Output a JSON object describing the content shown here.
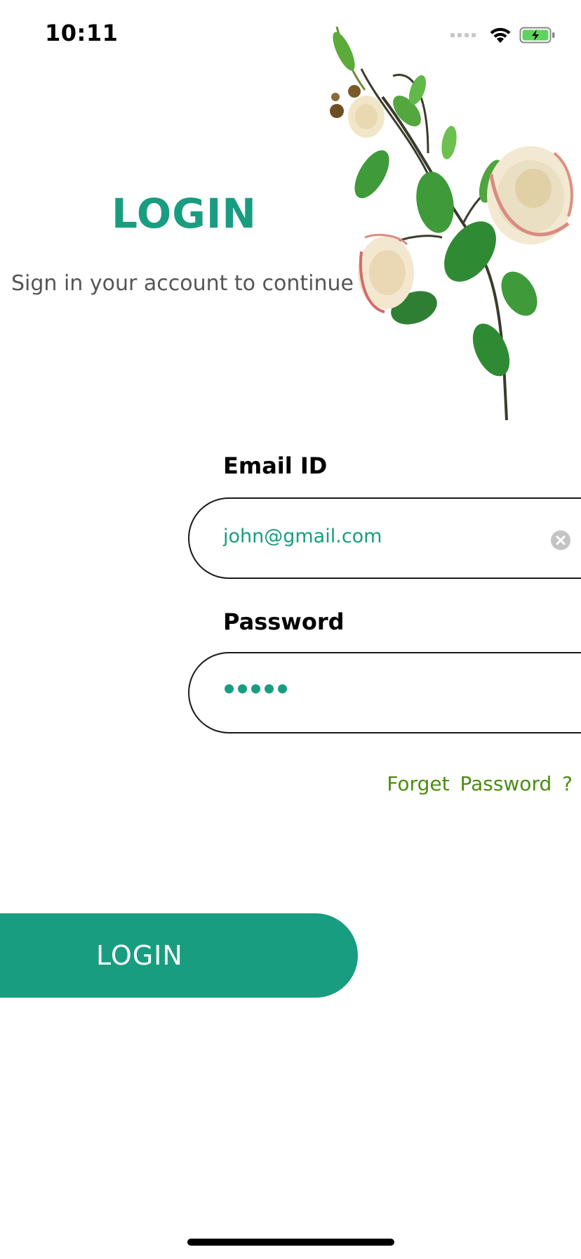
{
  "status_bar": {
    "time": "10:11",
    "icons": [
      "cellular-signal-icon",
      "wifi-icon",
      "battery-charging-icon"
    ]
  },
  "header": {
    "title": "LOGIN",
    "subtitle": "Sign in your account to continue"
  },
  "illustration": {
    "name": "rose-illustration"
  },
  "form": {
    "email": {
      "label": "Email ID",
      "value": "john@gmail.com"
    },
    "password": {
      "label": "Password",
      "masked_length": 5
    },
    "forgot_label": "Forget  Password ?"
  },
  "actions": {
    "login_label": "LOGIN"
  },
  "colors": {
    "accent": "#189d80",
    "link": "#4d8c12",
    "subtitle": "#555555"
  }
}
